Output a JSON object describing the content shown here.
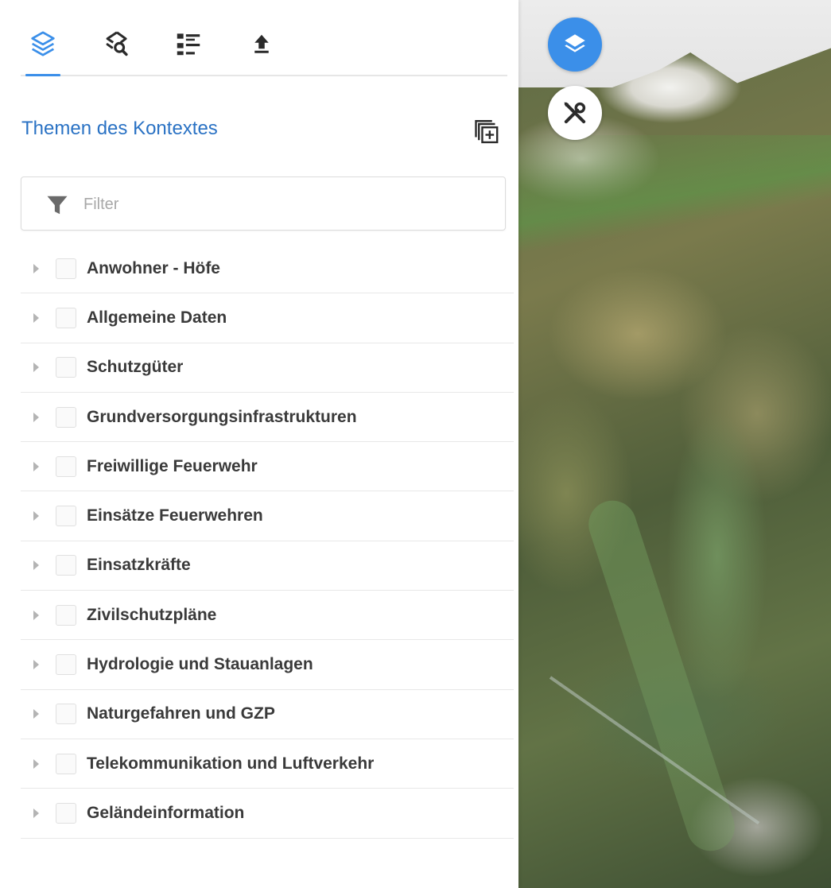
{
  "colors": {
    "accent": "#3b8fe9",
    "title": "#2a72c4",
    "icon_dark": "#2b2b2b",
    "text": "#3a3a3a"
  },
  "tabs": [
    {
      "icon": "layers-icon",
      "active": true
    },
    {
      "icon": "search-layers-icon",
      "active": false
    },
    {
      "icon": "legend-list-icon",
      "active": false
    },
    {
      "icon": "upload-icon",
      "active": false
    }
  ],
  "panel": {
    "title": "Themen des Kontextes",
    "add_context_icon": "add-context-icon"
  },
  "filter": {
    "placeholder": "Filter",
    "value": "",
    "icon": "filter-funnel-icon"
  },
  "themes": [
    {
      "label": "Anwohner - Höfe",
      "checked": false
    },
    {
      "label": "Allgemeine Daten",
      "checked": false
    },
    {
      "label": "Schutzgüter",
      "checked": false
    },
    {
      "label": "Grundversorgungsinfrastrukturen",
      "checked": false
    },
    {
      "label": "Freiwillige Feuerwehr",
      "checked": false
    },
    {
      "label": "Einsätze Feuerwehren",
      "checked": false
    },
    {
      "label": "Einsatzkräfte",
      "checked": false
    },
    {
      "label": "Zivilschutzpläne",
      "checked": false
    },
    {
      "label": "Hydrologie und Stauanlagen",
      "checked": false
    },
    {
      "label": "Naturgefahren und GZP",
      "checked": false
    },
    {
      "label": "Telekommunikation und Luftverkehr",
      "checked": false
    },
    {
      "label": "Geländeinformation",
      "checked": false
    }
  ],
  "map_controls": [
    {
      "icon": "layers-icon"
    },
    {
      "icon": "tools-icon"
    }
  ]
}
